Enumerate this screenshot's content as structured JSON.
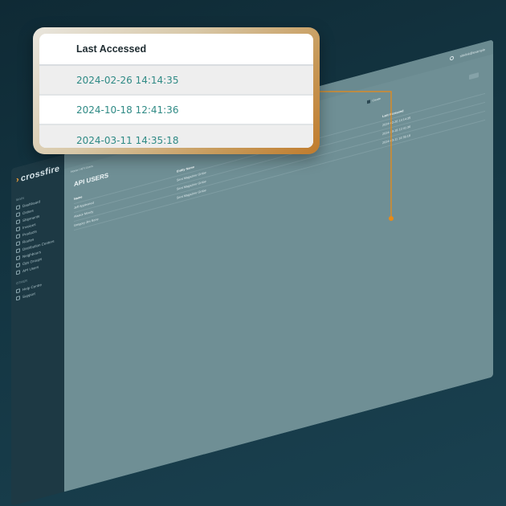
{
  "callout": {
    "column_header": "Last Accessed",
    "rows": [
      "2024-02-26 14:14:35",
      "2024-10-18 12:41:36",
      "2024-03-11 14:35:18"
    ]
  },
  "app": {
    "logo": "crossfire",
    "sidebar": {
      "section_main": "Main",
      "items": [
        "Dashboard",
        "Orders",
        "Shipments",
        "Invoices",
        "Products",
        "Routes",
        "Distribution Centers",
        "Neighbours",
        "Ops Groups",
        "API Users"
      ],
      "section_other": "Other",
      "other_items": [
        "Help Centre",
        "Support"
      ]
    },
    "topbar": {
      "user": "sitelink@example"
    },
    "breadcrumb": "Home / API Users",
    "page_title": "API USERS",
    "create_label": "Create",
    "table": {
      "headers": [
        "Name",
        "Entity Name",
        "Internal Customer ID",
        "Last Accessed"
      ],
      "rows": [
        [
          "Jeff Appleseed",
          "Sent Magazine Gmbe",
          "",
          "2024-02-26 14:14:35"
        ],
        [
          "Alastor Moody",
          "Sent Magazine Gmbe",
          "",
          "2024-10-18 12:41:36"
        ],
        [
          "Gregory Jim Sone",
          "Sent Magazine Gmbe",
          "",
          "2024-03-11 14:35:18"
        ]
      ]
    }
  },
  "colors": {
    "background": "#143643",
    "accent": "#f0a13a",
    "link_text": "#2f8a85",
    "connector": "#e98a16"
  }
}
